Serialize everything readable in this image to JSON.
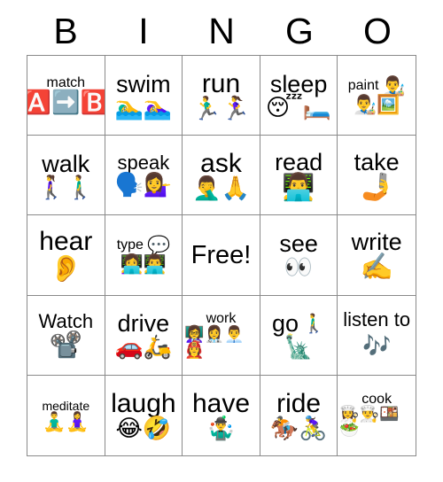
{
  "card": {
    "title_letters": [
      "B",
      "I",
      "N",
      "G",
      "O"
    ],
    "grid_size": "5x5",
    "free_space_text": "Free!"
  },
  "cells": [
    {
      "label": "match",
      "emojis": "🅰️➡️🅱️",
      "emoji_names": "a-button-icon, right-arrow-icon, b-button-icon"
    },
    {
      "label": "swim",
      "emojis": "🏊‍♂️🏊‍♀️",
      "emoji_names": "man-swimming-icon, woman-swimming-icon"
    },
    {
      "label": "run",
      "emojis": "🏃‍♂️🏃‍♀️",
      "emoji_names": "man-running-icon, woman-running-icon"
    },
    {
      "label": "sleep",
      "emojis": "😴🛏️",
      "emoji_names": "sleeping-face-icon, bed-icon"
    },
    {
      "label": "paint",
      "emojis_inline": "👨‍🎨",
      "emojis": "👨‍🎨🖼️",
      "emoji_names": "artist-icon, framed-picture-icon"
    },
    {
      "label": "walk",
      "emojis": "🚶‍♀️🚶‍♂️",
      "emoji_names": "woman-walking-icon, man-walking-icon"
    },
    {
      "label": "speak",
      "emojis": "🗣️💁‍♀️",
      "emoji_names": "speaking-head-icon, woman-tipping-hand-icon"
    },
    {
      "label": "ask",
      "emojis": "🤦‍♂️🙏",
      "emoji_names": "man-facepalming-icon, folded-hands-icon"
    },
    {
      "label": "read",
      "emojis": "👨‍💻",
      "emoji_names": "man-technologist-icon"
    },
    {
      "label": "take",
      "emojis": "🤳",
      "emoji_names": "selfie-icon"
    },
    {
      "label": "hear",
      "emojis": "👂",
      "emoji_names": "ear-icon"
    },
    {
      "label": "type",
      "emojis_inline": "💬",
      "emojis": "👩‍💻👨‍💻",
      "emoji_names": "speech-balloon-icon, woman-technologist-icon, man-technologist-icon"
    },
    {
      "label": "Free!",
      "emojis": "",
      "emoji_names": "free-space"
    },
    {
      "label": "see",
      "emojis": "👀",
      "emoji_names": "eyes-icon"
    },
    {
      "label": "write",
      "emojis": "✍️",
      "emoji_names": "writing-hand-icon"
    },
    {
      "label": "Watch",
      "emojis": "📽️",
      "emoji_names": "film-projector-icon"
    },
    {
      "label": "drive",
      "emojis": "🚗🛵",
      "emoji_names": "car-icon, motor-scooter-icon"
    },
    {
      "label": "work",
      "emojis": "👩‍🏫👩‍⚕️👨‍💼👩‍🚒",
      "emoji_names": "woman-teacher-icon, woman-health-worker-icon, man-office-worker-icon, woman-firefighter-icon"
    },
    {
      "label": "go",
      "emojis_inline": "🚶‍♂️",
      "emojis": "🗽",
      "emoji_names": "man-walking-icon, statue-of-liberty-icon"
    },
    {
      "label": "listen to",
      "emojis_inline": "🎶",
      "emojis": "",
      "emoji_names": "musical-notes-icon"
    },
    {
      "label": "meditate",
      "emojis": "🧘‍♂️🧘‍♀️",
      "emoji_names": "man-in-lotus-position-icon, woman-in-lotus-position-icon"
    },
    {
      "label": "laugh",
      "emojis": "😂🤣",
      "emoji_names": "face-with-tears-of-joy-icon, rolling-on-the-floor-laughing-icon"
    },
    {
      "label": "have",
      "emojis": "🤹‍♂️",
      "emoji_names": "man-juggling-icon"
    },
    {
      "label": "ride",
      "emojis": "🏇🚴‍♀️",
      "emoji_names": "horse-racing-icon, woman-biking-icon"
    },
    {
      "label": "cook",
      "emojis": "👩‍🍳👨‍🍳🍱🥗",
      "emoji_names": "woman-cook-icon, man-cook-icon, bento-box-icon, green-salad-icon"
    }
  ],
  "colors": {
    "background": "#ffffff",
    "grid_line": "#8a8a8a",
    "text": "#000000"
  }
}
